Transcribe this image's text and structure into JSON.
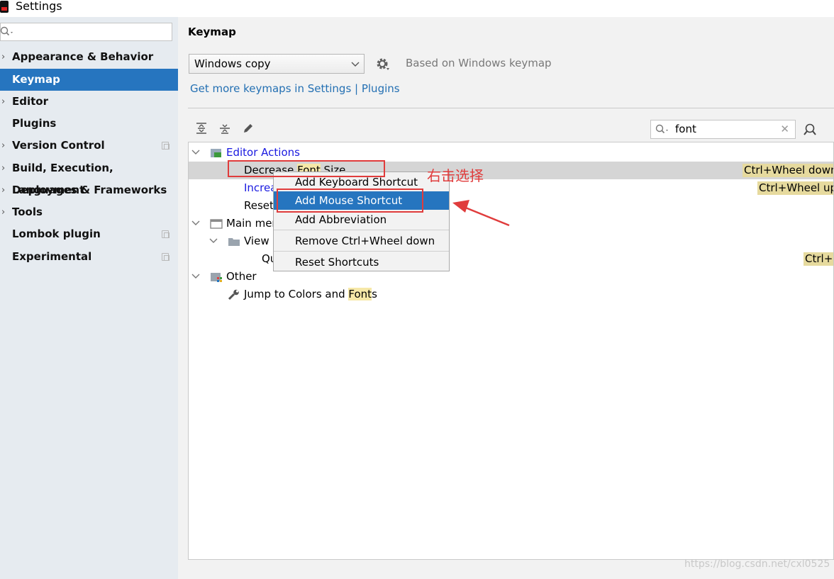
{
  "window": {
    "title": "Settings"
  },
  "sidebar": {
    "search_placeholder": "",
    "items": [
      {
        "label": "Appearance & Behavior",
        "expandable": true
      },
      {
        "label": "Keymap",
        "selected": true
      },
      {
        "label": "Editor",
        "expandable": true
      },
      {
        "label": "Plugins"
      },
      {
        "label": "Version Control",
        "expandable": true
      },
      {
        "label": "Build, Execution, Deployment",
        "expandable": true
      },
      {
        "label": "Languages & Frameworks",
        "expandable": true
      },
      {
        "label": "Tools",
        "expandable": true
      },
      {
        "label": "Lombok plugin"
      },
      {
        "label": "Experimental"
      }
    ]
  },
  "keymap": {
    "title": "Keymap",
    "selected_keymap": "Windows copy",
    "based_on": "Based on Windows keymap",
    "links": "Get more keymaps in Settings | Plugins",
    "filter_value": "font"
  },
  "tree": {
    "editor_actions": "Editor Actions",
    "decrease_pre": "Decrease ",
    "decrease_hl": "Font",
    "decrease_post": " Size",
    "decrease_shortcut": "Ctrl+Wheel down",
    "increase_partial": "Increa",
    "increase_shortcut": "Ctrl+Wheel up",
    "reset_partial": "Reset",
    "main_menu_partial": "Main mer",
    "view": "View",
    "quick_partial": "Qu",
    "quick_shortcut": "Ctrl+`",
    "other": "Other",
    "jump_pre": "Jump to Colors and ",
    "jump_hl": "Font",
    "jump_post": "s"
  },
  "context_menu": {
    "items": [
      "Add Keyboard Shortcut",
      "Add Mouse Shortcut",
      "Add Abbreviation",
      "Remove Ctrl+Wheel down",
      "Reset Shortcuts"
    ],
    "active_index": 1
  },
  "annotation": {
    "text": "右击选择",
    "color": "#e03c3c"
  },
  "watermark": "https://blog.csdn.net/cxl0525",
  "colors": {
    "accent": "#2675bf",
    "link": "#2470b3",
    "highlight": "#f6e8a8"
  }
}
